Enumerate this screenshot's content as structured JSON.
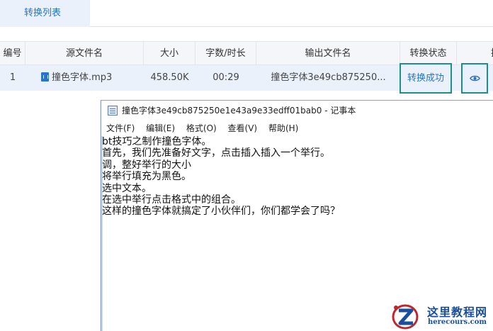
{
  "tabs": {
    "active_label": "转换列表"
  },
  "table": {
    "headers": [
      "编号",
      "源文件名",
      "大小",
      "字数/时长",
      "输出文件名",
      "转换状态",
      "操"
    ],
    "row": {
      "index": "1",
      "source_name": "撞色字体.mp3",
      "size": "458.50K",
      "duration": "00:29",
      "output_name": "撞色字体3e49cb875250...",
      "status": "转换成功"
    }
  },
  "notepad": {
    "title": "撞色字体3e49cb875250e1e43a9e33edff01bab0 - 记事本",
    "menu": [
      "文件(F)",
      "编辑(E)",
      "格式(O)",
      "查看(V)",
      "帮助(H)"
    ],
    "lines": [
      "bt技巧之制作撞色字体。",
      "首先，我们先准备好文字，点击插入插入一个举行。",
      "调，整好举行的大小",
      "将举行填充为黑色。",
      "选中文本。",
      "在选中举行点击格式中的组合。",
      "这样的撞色字体就搞定了小伙伴们，你们都学会了吗？"
    ]
  },
  "watermark": {
    "name": "这里教程网",
    "url": "herecours.com"
  },
  "colors": {
    "accent": "#2a73c6",
    "highlight_border": "#1d8f8a",
    "row_bg": "#eaf1fa"
  },
  "icons": {
    "file": "audio-file-icon",
    "preview": "eye-icon",
    "notepad": "notepad-icon"
  }
}
